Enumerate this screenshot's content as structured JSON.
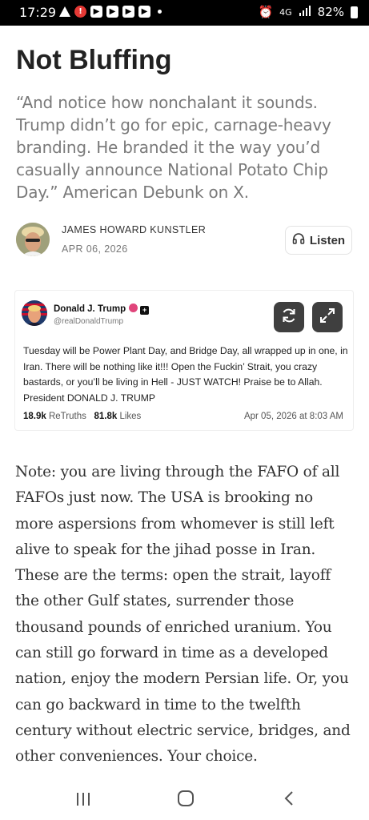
{
  "status_bar": {
    "time": "17:29",
    "network": "4G",
    "battery": "82%",
    "icons": [
      "warning-icon",
      "alert-icon",
      "youtube-icon",
      "youtube-icon",
      "youtube-icon",
      "youtube-icon",
      "dot-icon",
      "alarm-icon",
      "signal-icon",
      "battery-icon"
    ]
  },
  "article": {
    "title": "Not Bluffing",
    "subtitle": "“And notice how nonchalant it sounds. Trump didn’t go for epic, carnage-heavy branding. He branded it the way you’d casually announce National Potato Chip Day.” American Debunk on X.",
    "author": "JAMES HOWARD KUNSTLER",
    "date": "APR 06, 2026",
    "listen_label": "Listen",
    "body": "Note: you are living through the FAFO of all FAFOs just now. The USA is brooking no more aspersions from whomever is still left alive to speak for the jihad posse in Iran. These are the terms: open the strait, layoff the other Gulf states, surrender those thousand pounds of enriched uranium. You can still go forward in time as a developed nation, enjoy the modern Persian life. Or, you can go backward in time to the twelfth century without electric service, bridges, and other conveniences. Your choice."
  },
  "embedded_post": {
    "name": "Donald J. Trump",
    "handle": "@realDonaldTrump",
    "text": "Tuesday will be Power Plant Day, and Bridge Day, all wrapped up in one, in Iran. There will be nothing like it!!! Open the Fuckin’ Strait, you crazy bastards, or you’ll be living in Hell - JUST WATCH! Praise be to Allah. President DONALD J. TRUMP",
    "retruths_count": "18.9k",
    "retruths_label": "ReTruths",
    "likes_count": "81.8k",
    "likes_label": "Likes",
    "timestamp": "Apr 05, 2026 at 8:03 AM",
    "badge_color": "#e0457b",
    "button_color": "#3f3f3f"
  },
  "nav_bar": {
    "icons": [
      "recent-apps-icon",
      "home-icon",
      "back-icon"
    ]
  }
}
